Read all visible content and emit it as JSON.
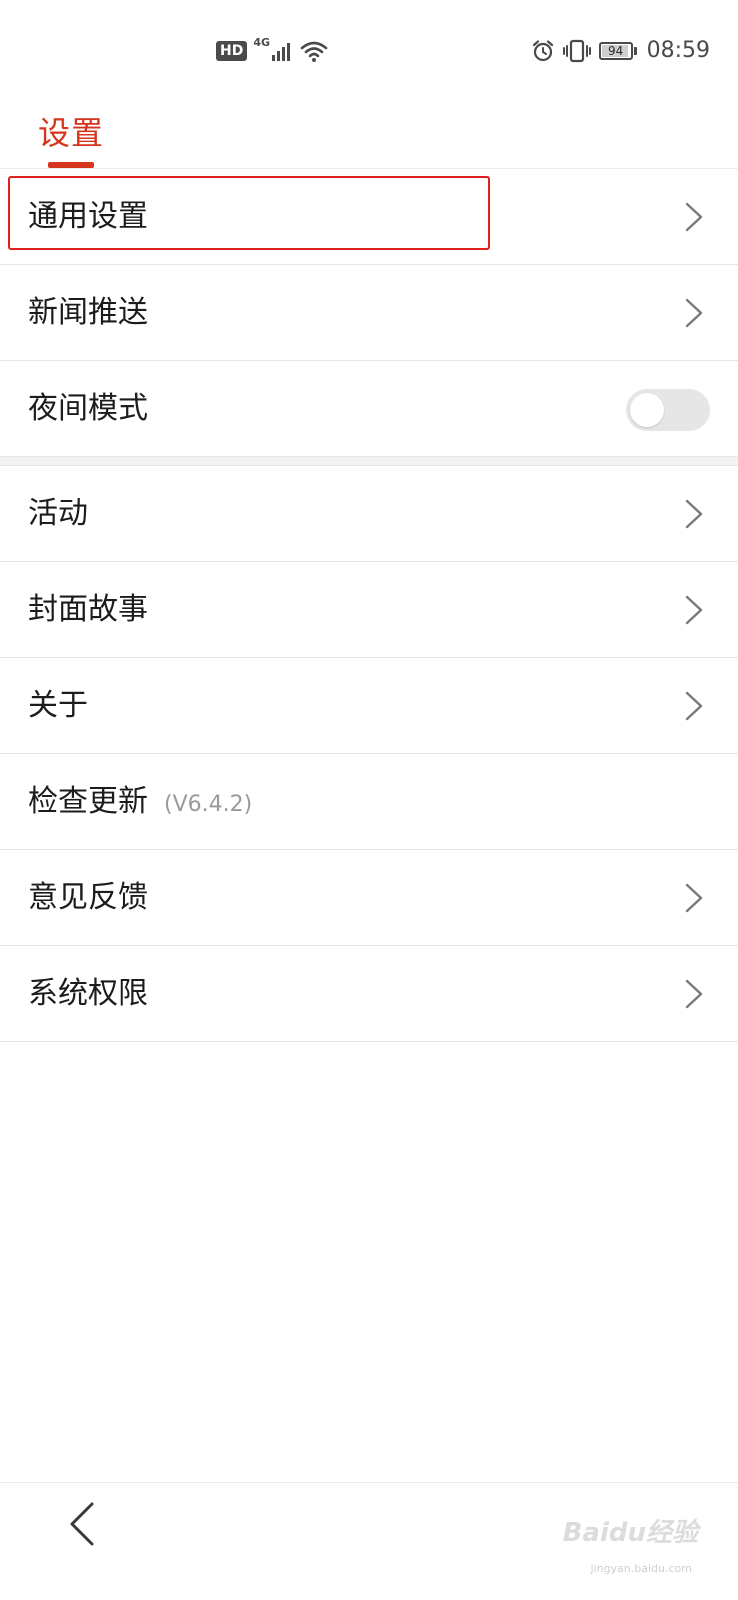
{
  "status_bar": {
    "hd": "HD",
    "network": "4G",
    "battery_level": "94",
    "battery_fraction": 0.94,
    "time": "08:59",
    "icons": {
      "signal": "signal-bars-icon",
      "wifi": "wifi-icon",
      "alarm": "alarm-clock-icon",
      "vibrate": "vibrate-icon",
      "battery": "battery-icon"
    }
  },
  "header": {
    "title": "设置",
    "accent_color": "#d4351c"
  },
  "settings": {
    "items": [
      {
        "label": "通用设置",
        "control": "chevron",
        "highlighted": true
      },
      {
        "label": "新闻推送",
        "control": "chevron"
      },
      {
        "label": "夜间模式",
        "control": "toggle",
        "toggle_on": false
      },
      {
        "label": "活动",
        "control": "chevron"
      },
      {
        "label": "封面故事",
        "control": "chevron"
      },
      {
        "label": "关于",
        "control": "chevron"
      },
      {
        "label": "检查更新",
        "version": "(V6.4.2)",
        "control": "none"
      },
      {
        "label": "意见反馈",
        "control": "chevron"
      },
      {
        "label": "系统权限",
        "control": "chevron"
      }
    ]
  },
  "bottom_nav": {
    "back_icon": "chevron-left-icon"
  },
  "watermark": {
    "text": "Baidu经验",
    "sub": "jingyan.baidu.com"
  }
}
